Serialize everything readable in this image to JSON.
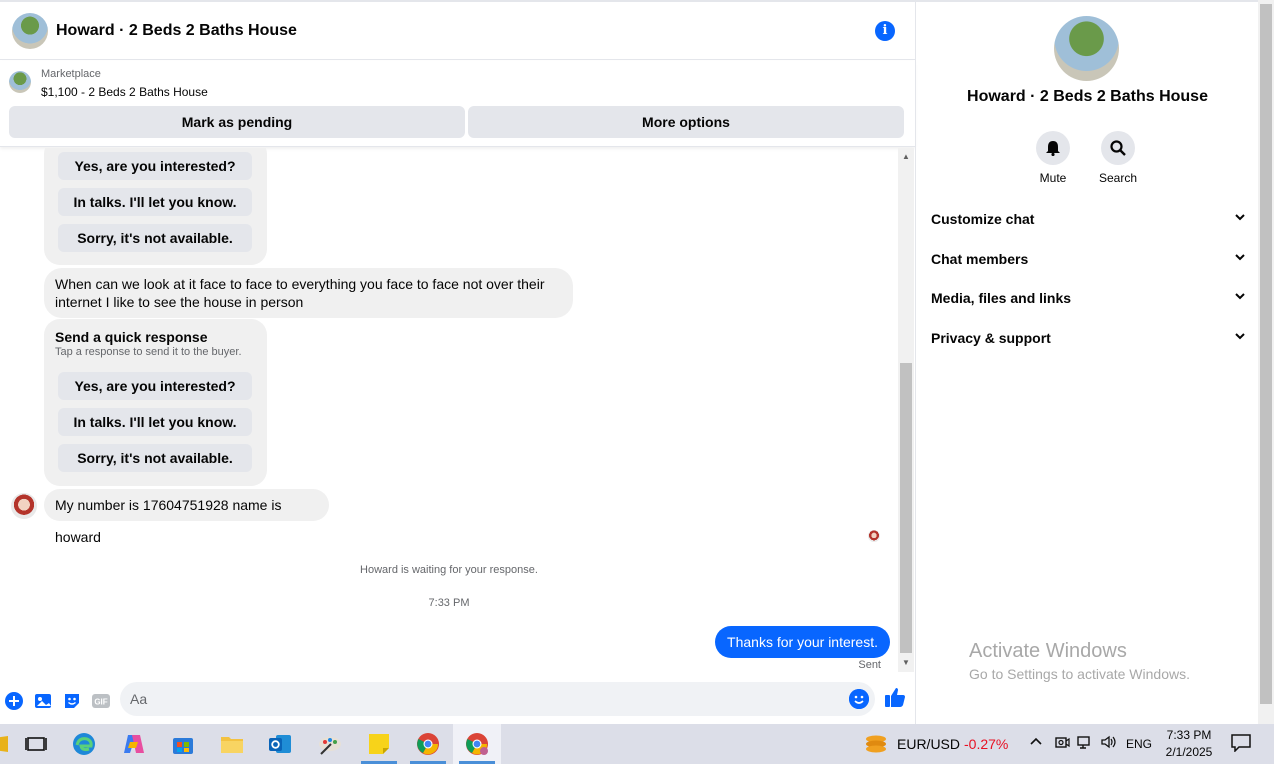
{
  "header": {
    "title": "Howard · 2 Beds 2 Baths House",
    "info_icon": "info-icon"
  },
  "marketplace": {
    "label": "Marketplace",
    "listing": "$1,100 - 2 Beds 2 Baths House",
    "mark_pending": "Mark as pending",
    "more_options": "More options"
  },
  "messages": {
    "quick_replies_top": [
      "Yes, are you interested?",
      "In talks. I'll let you know.",
      "Sorry, it's not available."
    ],
    "buyer_msg1_line1": "When can we look at it face to face to everything you face to face not over their",
    "buyer_msg1_line2": "internet I like to see the house in person",
    "quick_title": "Send a quick response",
    "quick_sub": "Tap a response to send it to the buyer.",
    "quick_replies": [
      "Yes, are you interested?",
      "In talks. I'll let you know.",
      "Sorry, it's not available."
    ],
    "buyer_msg2": "My number is 17604751928 name is howard",
    "waiting": "Howard is waiting for your response.",
    "time": "7:33 PM",
    "sent_msg": "Thanks for your interest.",
    "sent_status": "Sent"
  },
  "composer": {
    "placeholder": "Aa"
  },
  "info_panel": {
    "title": "Howard · 2 Beds 2 Baths House",
    "mute": "Mute",
    "search": "Search",
    "sections": [
      "Customize chat",
      "Chat members",
      "Media, files and links",
      "Privacy & support"
    ]
  },
  "watermark": {
    "title": "Activate Windows",
    "sub": "Go to Settings to activate Windows."
  },
  "taskbar": {
    "ticker": "EUR/USD",
    "change": "-0.27%",
    "lang": "ENG",
    "time": "7:33 PM",
    "date": "2/1/2025"
  },
  "colors": {
    "accent": "#0866ff",
    "negative": "#e81123"
  }
}
